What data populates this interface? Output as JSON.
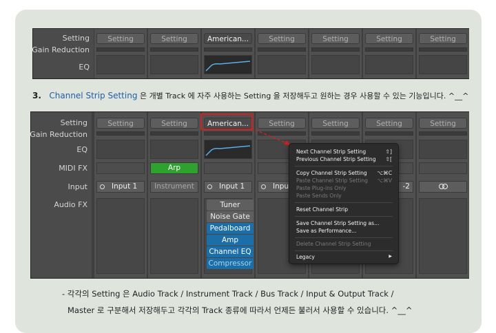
{
  "top_panel": {
    "labels": {
      "setting": "Setting",
      "gain_reduction": "Gain Reduction",
      "eq": "EQ"
    },
    "setting_buttons": [
      "Setting",
      "Setting",
      "American...",
      "Setting",
      "Setting",
      "Setting",
      "Setting"
    ]
  },
  "caption1": {
    "number": "3.",
    "highlight": "Channel Strip Setting",
    "text": " 은 개별 Track 에 자주 사용하는 Setting 을 저장해두고 원하는 경우 사용할 수 있는 기능입니다. ^__^"
  },
  "mixer": {
    "labels": {
      "setting": "Setting",
      "gain_reduction": "Gain Reduction",
      "eq": "EQ",
      "midi_fx": "MIDI FX",
      "input": "Input",
      "audio_fx": "Audio FX"
    },
    "setting_buttons": [
      "Setting",
      "Setting",
      "American...",
      "Setting",
      "Setting",
      "Setting",
      "Setting"
    ],
    "midi_fx_slot": "Arp",
    "inputs": [
      "Input 1",
      "Instrument",
      "Input 1",
      "Inpu",
      "",
      "-2",
      ""
    ],
    "plugins": [
      "Tuner",
      "Noise Gate",
      "Pedalboard",
      "Amp",
      "Channel EQ",
      "Compressor"
    ]
  },
  "context_menu": {
    "items": [
      {
        "label": "Next Channel Strip Setting",
        "shortcut": "⇧]",
        "enabled": true
      },
      {
        "label": "Previous Channel Strip Setting",
        "shortcut": "⇧[",
        "enabled": true
      },
      {
        "label": "Copy Channel Strip Setting",
        "shortcut": "⌥⌘C",
        "enabled": true
      },
      {
        "label": "Paste Channel Strip Setting",
        "shortcut": "⌥⌘V",
        "enabled": false
      },
      {
        "label": "Paste Plug-ins Only",
        "shortcut": "",
        "enabled": false
      },
      {
        "label": "Paste Sends Only",
        "shortcut": "",
        "enabled": false
      },
      {
        "label": "Reset Channel Strip",
        "shortcut": "",
        "enabled": true
      },
      {
        "label": "Save Channel Strip Setting as...",
        "shortcut": "",
        "enabled": true
      },
      {
        "label": "Save as Performance...",
        "shortcut": "",
        "enabled": true
      },
      {
        "label": "Delete Channel Strip Setting",
        "shortcut": "",
        "enabled": false
      },
      {
        "label": "Legacy",
        "shortcut": "▶",
        "enabled": true
      }
    ]
  },
  "caption2": {
    "line1": "- 각각의 Setting 은 Audio Track / Instrument Track / Bus Track / Input & Output Track /",
    "line2": "Master 로 구분해서 저장해두고 각각의 Track 종류에 따라서 언제든 불러서 사용할 수 있습니다. ^__^"
  },
  "colors": {
    "highlight_text": "#1f5fa8",
    "callout_red": "#d02020",
    "plugin_blue": "#1b6ea8",
    "arp_green": "#3aa83a",
    "eq_curve": "#5ab0e8"
  }
}
